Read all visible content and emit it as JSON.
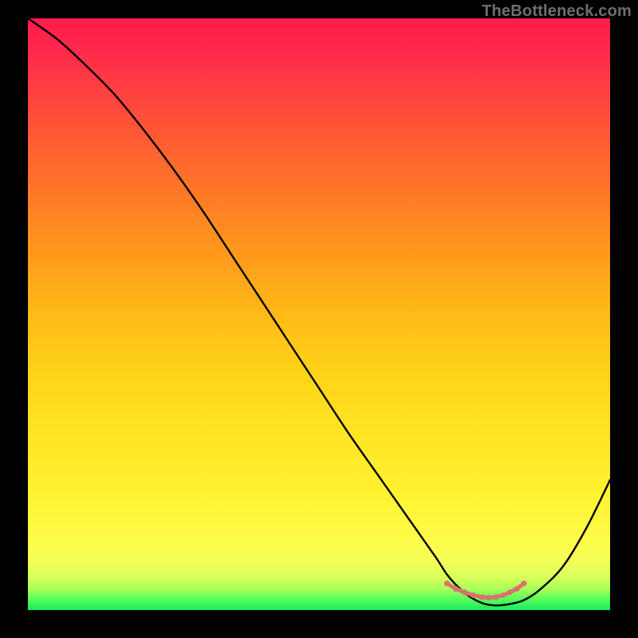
{
  "watermark": "TheBottleneck.com",
  "chart_data": {
    "type": "line",
    "title": "",
    "xlabel": "",
    "ylabel": "",
    "xlim": [
      0,
      100
    ],
    "ylim": [
      0,
      100
    ],
    "grid": false,
    "series": [
      {
        "name": "bottleneck-curve",
        "x": [
          0,
          5,
          10,
          15,
          20,
          25,
          30,
          35,
          40,
          45,
          50,
          55,
          60,
          65,
          70,
          72,
          74,
          76,
          78,
          80,
          82,
          85,
          88,
          92,
          96,
          100
        ],
        "y": [
          100,
          96.5,
          92,
          87,
          81,
          74.5,
          67.5,
          60,
          52.5,
          45,
          37.5,
          30,
          23,
          16,
          9,
          6,
          3.8,
          2.2,
          1.2,
          0.8,
          0.9,
          1.6,
          3.5,
          7.5,
          14,
          22
        ]
      }
    ],
    "highlight": {
      "name": "sweet-spot",
      "x": [
        72,
        73.5,
        75,
        76.5,
        78,
        79.2,
        80.4,
        81.6,
        82.8,
        84,
        85.2
      ],
      "y": [
        4.5,
        3.6,
        3.0,
        2.5,
        2.2,
        2.1,
        2.2,
        2.5,
        3.0,
        3.6,
        4.5
      ],
      "color": "#d9736b"
    },
    "gradient_stops": [
      {
        "offset": 0.0,
        "color": "#ff1a4b"
      },
      {
        "offset": 0.06,
        "color": "#ff2b4b"
      },
      {
        "offset": 0.12,
        "color": "#ff3f42"
      },
      {
        "offset": 0.2,
        "color": "#ff5a34"
      },
      {
        "offset": 0.3,
        "color": "#ff7a26"
      },
      {
        "offset": 0.4,
        "color": "#ff9a1c"
      },
      {
        "offset": 0.5,
        "color": "#ffba18"
      },
      {
        "offset": 0.6,
        "color": "#ffd318"
      },
      {
        "offset": 0.7,
        "color": "#ffe424"
      },
      {
        "offset": 0.8,
        "color": "#fff230"
      },
      {
        "offset": 0.87,
        "color": "#fffb46"
      },
      {
        "offset": 0.915,
        "color": "#f7ff58"
      },
      {
        "offset": 0.945,
        "color": "#d8ff5a"
      },
      {
        "offset": 0.965,
        "color": "#a6ff58"
      },
      {
        "offset": 0.98,
        "color": "#5eff5a"
      },
      {
        "offset": 1.0,
        "color": "#19e85e"
      }
    ]
  }
}
